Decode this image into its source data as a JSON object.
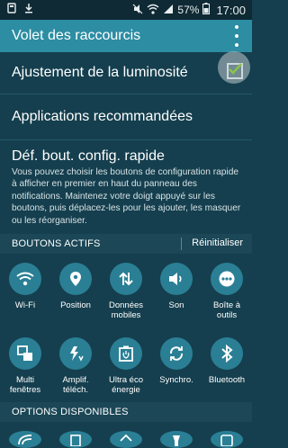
{
  "status_bar": {
    "battery": "57%",
    "time": "17:00",
    "icons": [
      "notification-icon",
      "download-icon",
      "mute-icon",
      "wifi-icon",
      "signal-icon",
      "battery-icon"
    ]
  },
  "app_bar": {
    "title": "Volet des raccourcis",
    "menu_icon": "overflow-menu-icon"
  },
  "settings": {
    "brightness": {
      "label": "Ajustement de la luminosité",
      "checked": true
    },
    "recommended_apps": {
      "label": "Applications recommandées"
    },
    "quick_config": {
      "title": "Déf. bout. config. rapide",
      "description": "Vous pouvez choisir les boutons de configuration rapide à afficher en premier en haut du panneau des notifications. Maintenez votre doigt appuyé sur les boutons, puis déplacez-les pour les ajouter, les masquer ou les réorganiser."
    }
  },
  "active_section": {
    "header": "BOUTONS ACTIFS",
    "reset_label": "Réinitialiser",
    "buttons": [
      {
        "label": "Wi-Fi",
        "icon": "wifi-icon"
      },
      {
        "label": "Position",
        "icon": "location-icon"
      },
      {
        "label": "Données\nmobiles",
        "icon": "mobile-data-icon"
      },
      {
        "label": "Son",
        "icon": "sound-icon"
      },
      {
        "label": "Boîte à\noutils",
        "icon": "toolbox-icon"
      },
      {
        "label": "Multi\nfenêtres",
        "icon": "multi-window-icon"
      },
      {
        "label": "Amplif.\ntéléch.",
        "icon": "download-booster-icon"
      },
      {
        "label": "Ultra éco\nénergie",
        "icon": "ultra-power-saving-icon"
      },
      {
        "label": "Synchro.",
        "icon": "sync-icon"
      },
      {
        "label": "Bluetooth",
        "icon": "bluetooth-icon"
      }
    ]
  },
  "available_section": {
    "header": "OPTIONS DISPONIBLES",
    "icons": [
      "hotspot-icon",
      "screen-rotation-icon",
      "private-mode-icon",
      "flashlight-icon",
      "nfc-icon"
    ]
  },
  "colors": {
    "accent": "#2c8da3",
    "check": "#8bc34a",
    "background": "#153f4e"
  }
}
